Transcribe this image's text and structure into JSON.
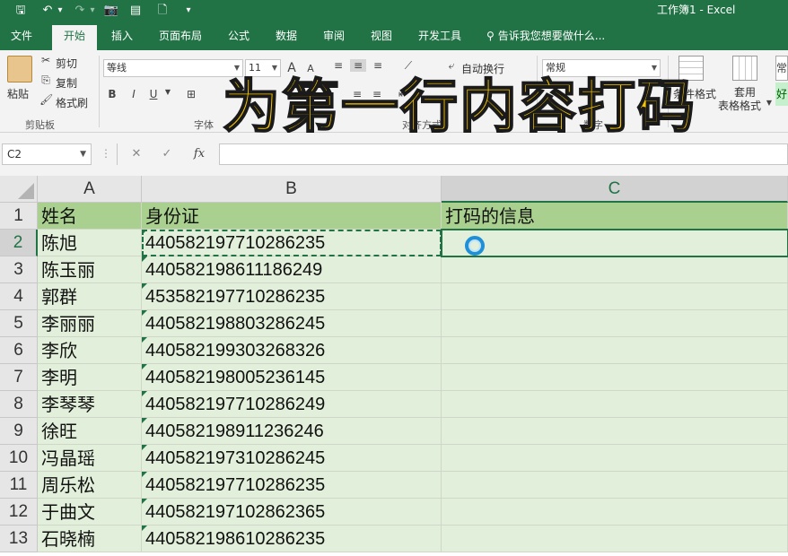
{
  "window": {
    "title": "工作簿1 - Excel",
    "quick_access": {
      "save": "🖫",
      "undo": "↶",
      "undo_dropdown": "▾",
      "redo": "↷",
      "redo_dropdown": "▾",
      "camera": "📷",
      "new": "🗋",
      "more": "▾"
    }
  },
  "tabs": {
    "file": "文件",
    "home": "开始",
    "insert": "插入",
    "page_layout": "页面布局",
    "formulas": "公式",
    "data": "数据",
    "review": "审阅",
    "view": "视图",
    "developer": "开发工具",
    "tell_me": "告诉我您想要做什么..."
  },
  "ribbon": {
    "clipboard": {
      "paste": "粘贴",
      "cut": "剪切",
      "copy": "复制",
      "format_painter": "格式刷",
      "group": "剪贴板"
    },
    "font": {
      "name": "等线",
      "size": "11",
      "grow": "A",
      "shrink": "A",
      "bold": "B",
      "italic": "I",
      "underline": "U",
      "group": "字体"
    },
    "alignment": {
      "wrap": "自动换行",
      "group": "对齐方式"
    },
    "number": {
      "format": "常规",
      "group": "数字"
    },
    "styles": {
      "conditional": "条件格式",
      "table_style_line1": "套用",
      "table_style_line2": "表格格式",
      "cell_style": "常",
      "good": "好"
    }
  },
  "overlay_title": "为第一行内容打码",
  "formula_bar": {
    "name_box": "C2",
    "cancel": "✕",
    "enter": "✓",
    "fx": "fx",
    "content": ""
  },
  "sheet": {
    "columns": [
      "A",
      "B",
      "C"
    ],
    "selected_column": "C",
    "selected_row": 2,
    "header_row": {
      "row": "1",
      "a": "姓名",
      "b": "身份证",
      "c": "打码的信息"
    },
    "rows": [
      {
        "row": "2",
        "name": "陈旭",
        "id": "44058219771028623​5"
      },
      {
        "row": "3",
        "name": "陈玉丽",
        "id": "440582198611186249"
      },
      {
        "row": "4",
        "name": "郭群",
        "id": "453582197710286235"
      },
      {
        "row": "5",
        "name": "李丽丽",
        "id": "440582198803286245"
      },
      {
        "row": "6",
        "name": "李欣",
        "id": "440582199303268326"
      },
      {
        "row": "7",
        "name": "李明",
        "id": "440582198005236145"
      },
      {
        "row": "8",
        "name": "李琴琴",
        "id": "440582197710286249"
      },
      {
        "row": "9",
        "name": "徐旺",
        "id": "440582198911236246"
      },
      {
        "row": "10",
        "name": "冯晶瑶",
        "id": "440582197310286245"
      },
      {
        "row": "11",
        "name": "周乐松",
        "id": "440582197710286235"
      },
      {
        "row": "12",
        "name": "于曲文",
        "id": "440582197102862365"
      },
      {
        "row": "13",
        "name": "石晓楠",
        "id": "440582198610286235"
      }
    ]
  },
  "colors": {
    "brand": "#217346",
    "header_fill": "#a9d08e",
    "body_fill": "#e2efda",
    "overlay": "#f7c600"
  }
}
